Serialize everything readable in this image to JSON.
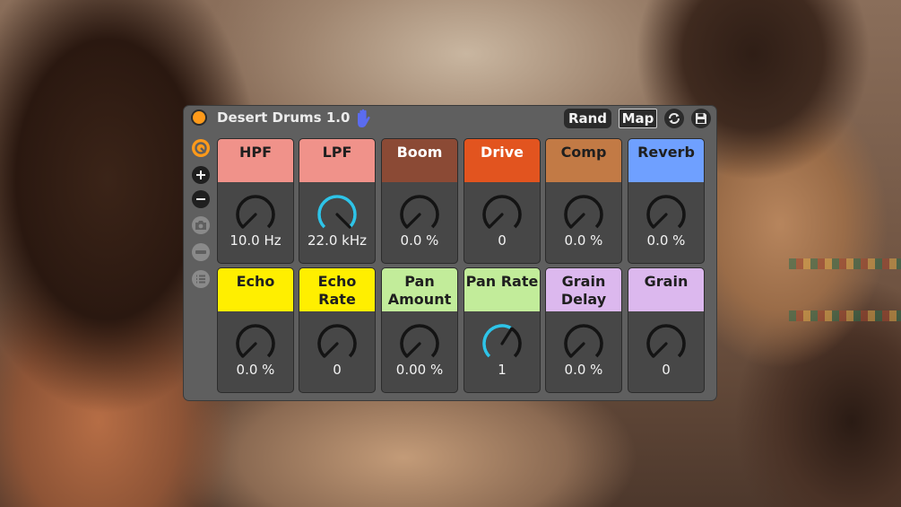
{
  "device": {
    "title": "Desert Drums 1.0",
    "rand_label": "Rand",
    "map_label": "Map",
    "accent_color": "#ff9a1a",
    "hand_icon_color": "#5b6cf0"
  },
  "sidebar": {
    "icons": [
      "hot-swap-icon",
      "plus-icon",
      "minus-icon",
      "camera-icon",
      "collapse-icon",
      "list-icon"
    ]
  },
  "pads": [
    {
      "label": "HPF",
      "value": "10.0 Hz",
      "color": "#f0928a",
      "knob_level": 0.0,
      "knob_active": false
    },
    {
      "label": "LPF",
      "value": "22.0 kHz",
      "color": "#f0928a",
      "knob_level": 1.0,
      "knob_active": true
    },
    {
      "label": "Boom",
      "value": "0.0 %",
      "color": "#8b4a35",
      "knob_level": 0.0,
      "knob_active": false
    },
    {
      "label": "Drive",
      "value": "0",
      "color": "#e2541f",
      "knob_level": 0.0,
      "knob_active": false
    },
    {
      "label": "Comp",
      "value": "0.0 %",
      "color": "#c27a45",
      "knob_level": 0.0,
      "knob_active": false
    },
    {
      "label": "Reverb",
      "value": "0.0 %",
      "color": "#6fa0ff",
      "knob_level": 0.0,
      "knob_active": false
    },
    {
      "label": "Echo",
      "value": "0.0 %",
      "color": "#ffef00",
      "knob_level": 0.0,
      "knob_active": false
    },
    {
      "label": "Echo\nRate",
      "value": "0",
      "color": "#ffef00",
      "knob_level": 0.0,
      "knob_active": false
    },
    {
      "label": "Pan\nAmount",
      "value": "0.00 %",
      "color": "#c2ec9a",
      "knob_level": 0.0,
      "knob_active": false
    },
    {
      "label": "Pan Rate",
      "value": "1",
      "color": "#c2ec9a",
      "knob_level": 0.62,
      "knob_active": true
    },
    {
      "label": "Grain\nDelay",
      "value": "0.0 %",
      "color": "#dcb8ee",
      "knob_level": 0.0,
      "knob_active": false
    },
    {
      "label": "Grain",
      "value": "0",
      "color": "#dcb8ee",
      "knob_level": 0.0,
      "knob_active": false
    }
  ]
}
